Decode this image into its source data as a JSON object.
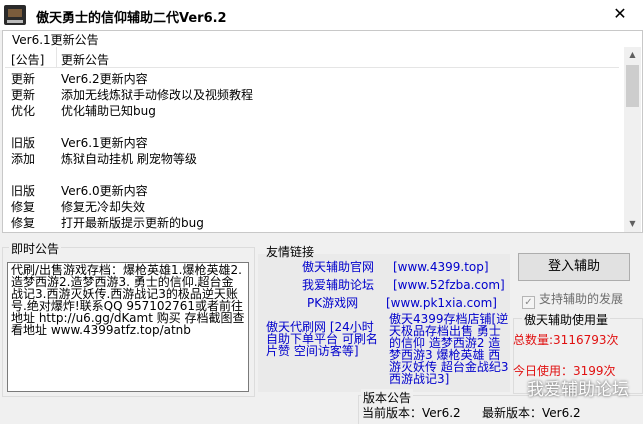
{
  "window": {
    "title": "傲天勇士的信仰辅助二代Ver6.2",
    "close": "✕"
  },
  "notice": {
    "tab_label": "Ver6.1更新公告",
    "columns": [
      "[公告]",
      "更新公告"
    ],
    "rows": [
      {
        "type": "更新",
        "content": "Ver6.2更新内容"
      },
      {
        "type": "更新",
        "content": "添加无线炼狱手动修改以及视频教程"
      },
      {
        "type": "优化",
        "content": "优化辅助已知bug"
      },
      {
        "type": "",
        "content": ""
      },
      {
        "type": "旧版",
        "content": "Ver6.1更新内容"
      },
      {
        "type": "添加",
        "content": "炼狱自动挂机 刷宠物等级"
      },
      {
        "type": "",
        "content": ""
      },
      {
        "type": "旧版",
        "content": "Ver6.0更新内容"
      },
      {
        "type": "修复",
        "content": "修复无冷却失效"
      },
      {
        "type": "修复",
        "content": "打开最新版提示更新的bug"
      }
    ]
  },
  "instant_notice": {
    "title": "即时公告",
    "text": "代刷/出售游戏存档：爆枪英雄1.爆枪英雄2.造梦西游2.造梦西游3. 勇士的信仰.超台金战记3.西游灭妖传.西游战记3的极品逆天账号.绝对爆炸!联系QQ 957102761或者前往地址 http://u6.gg/dKamt 购买 存档截图查看地址 www.4399atfz.top/atnb"
  },
  "friend_links": {
    "title": "友情链接",
    "official": "傲天辅助官网",
    "official_url": "[www.4399.top]",
    "forum": "我爱辅助论坛",
    "forum_url": "[www.52fzba.com]",
    "pk": "PK游戏网",
    "pk_url": "[www.pk1xia.com]",
    "agent": "傲天代刷网 [24小时自助下单平台 可刷名片赞 空间访客等]",
    "store": "傲天4399存档店铺[逆天极品存档出售 勇士的信仰 造梦西游2 造梦西游3 爆枪英雄 西游灭妖传 超台金战纪3 西游战记3]"
  },
  "actions": {
    "login": "登入辅助",
    "support": "支持辅助的发展"
  },
  "usage": {
    "title": "傲天辅助使用量",
    "total": "总数量:3116793次",
    "today": "今日使用：3199次"
  },
  "version": {
    "title": "版本公告",
    "current": "当前版本：Ver6.2",
    "latest": "最新版本：Ver6.2"
  },
  "watermark": "我爱辅助论坛"
}
